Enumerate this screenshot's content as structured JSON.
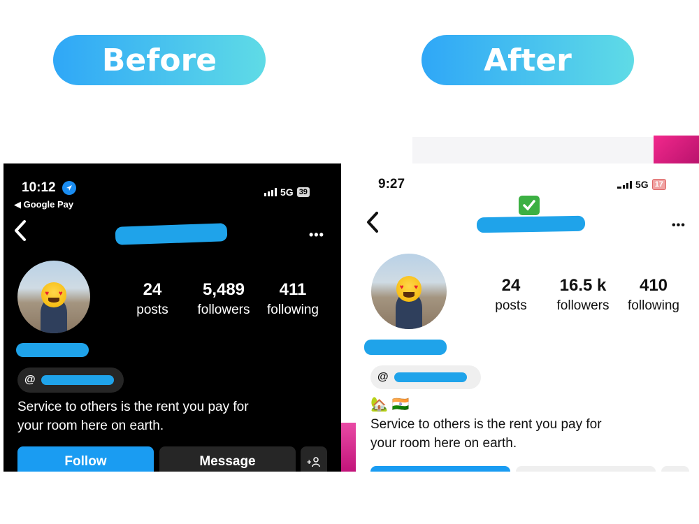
{
  "labels": {
    "before": "Before",
    "after": "After"
  },
  "before": {
    "status": {
      "time": "10:12",
      "back_app": "◀ Google Pay",
      "network": "5G",
      "battery": "39"
    },
    "stats": [
      {
        "num": "24",
        "lbl": "posts"
      },
      {
        "num": "5,489",
        "lbl": "followers"
      },
      {
        "num": "411",
        "lbl": "following"
      }
    ],
    "bio": [
      "Service to others is the rent you pay for",
      "your room here on earth."
    ],
    "buttons": {
      "follow": "Follow",
      "message": "Message"
    },
    "icons": [
      "location-arrow-icon",
      "back-chevron-icon",
      "more-options-icon",
      "threads-icon",
      "add-person-icon"
    ]
  },
  "after": {
    "status": {
      "time": "9:27",
      "network": "5G",
      "battery": "17"
    },
    "stats": [
      {
        "num": "24",
        "lbl": "posts"
      },
      {
        "num": "16.5 k",
        "lbl": "followers"
      },
      {
        "num": "410",
        "lbl": "following"
      }
    ],
    "bio_emoji": "🏡 🇮🇳",
    "bio": [
      "Service to others is the rent you pay for",
      "your room here on earth."
    ],
    "icons": [
      "back-chevron-icon",
      "verified-check-icon",
      "more-options-icon",
      "threads-icon"
    ]
  },
  "colors": {
    "pill_start": "#2fa7f7",
    "pill_end": "#5fdbe6",
    "follow_blue": "#1a9cf2",
    "scribble": "#1fa3ea"
  }
}
